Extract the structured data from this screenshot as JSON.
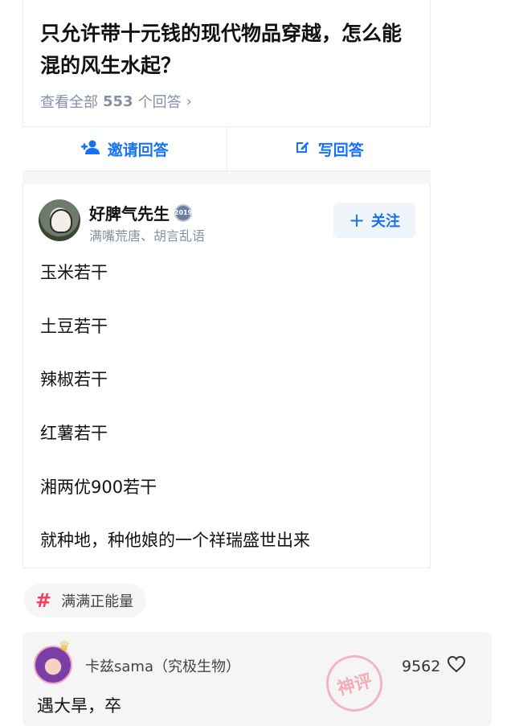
{
  "question": {
    "title": "只允许带十元钱的现代物品穿越，怎么能混的风生水起？",
    "view_all_prefix": "查看全部",
    "answer_count": "553",
    "view_all_suffix": "个回答",
    "chevron": "›"
  },
  "actions": {
    "invite_label": "邀请回答",
    "write_label": "写回答",
    "invite_icon": "add-user-icon",
    "write_icon": "edit-icon"
  },
  "author": {
    "name": "好脾气先生",
    "badge_text": "2019",
    "bio": "满嘴荒唐、胡言乱语",
    "follow_label": "关注",
    "follow_plus": "+"
  },
  "answer_lines": [
    "玉米若干",
    "土豆若干",
    "辣椒若干",
    "红薯若干",
    "湘两优900若干",
    "就种地，种他娘的一个祥瑞盛世出来"
  ],
  "tag": {
    "hash": "#",
    "label": "满满正能量"
  },
  "comment": {
    "author": "卡兹sama（究极生物）",
    "likes": "9562",
    "text": "遇大旱，卒",
    "stamp_text": "神评"
  },
  "colors": {
    "accent": "#1772f6",
    "tag_hash": "#f1405c",
    "muted": "#8590a6"
  }
}
